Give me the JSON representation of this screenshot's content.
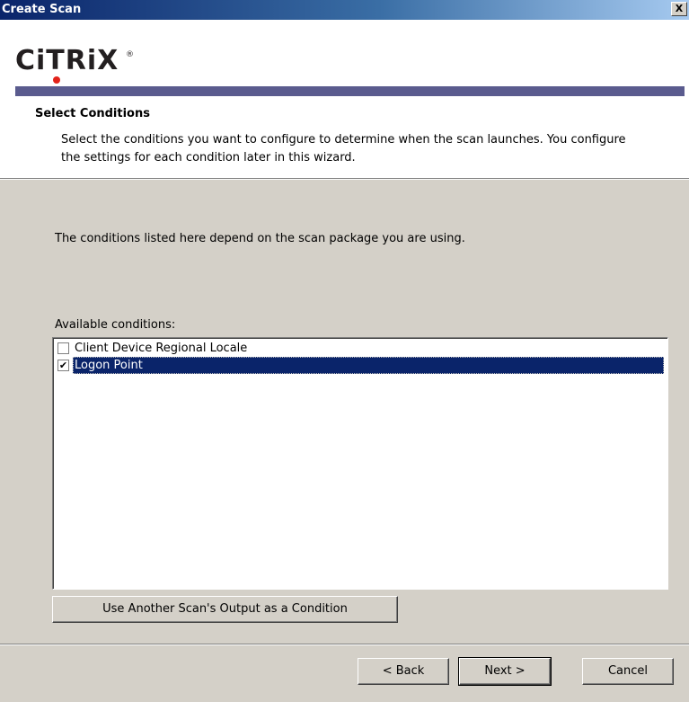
{
  "window": {
    "title": "Create Scan",
    "close_label": "X"
  },
  "header": {
    "logo_text": "CiTRiX",
    "logo_trademark": "®",
    "section_title": "Select Conditions",
    "section_desc": "Select the conditions you want to configure to determine when the scan launches. You configure the settings for each condition later in this wizard."
  },
  "body": {
    "info_text": "The conditions listed here depend on the scan package you are using.",
    "available_label": "Available conditions:",
    "conditions": [
      {
        "label": "Client Device Regional Locale",
        "checked": false,
        "selected": false
      },
      {
        "label": "Logon Point",
        "checked": true,
        "selected": true
      }
    ],
    "use_output_button": "Use Another Scan's Output as a Condition"
  },
  "footer": {
    "back_label": "< Back",
    "next_label": "Next >",
    "cancel_label": "Cancel"
  },
  "colors": {
    "title_bar_start": "#0a246a",
    "logo_bar": "#5a5b8e",
    "selection": "#0a246a",
    "logo_dot": "#e2231a"
  }
}
